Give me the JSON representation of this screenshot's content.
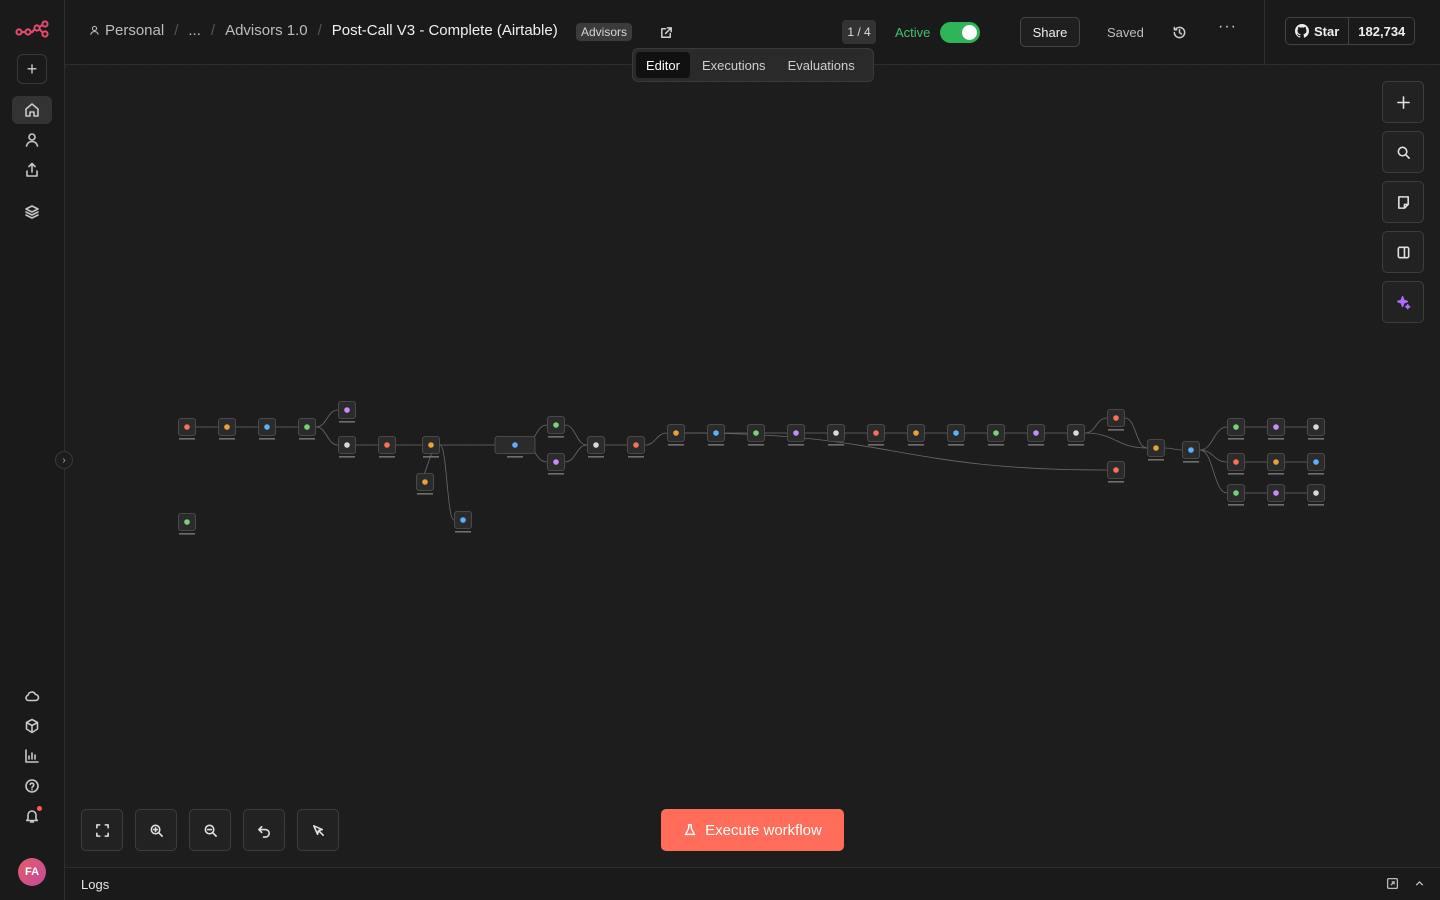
{
  "header": {
    "breadcrumbs": [
      "Personal",
      "...",
      "Advisors 1.0"
    ],
    "workflow_title": "Post-Call V3 - Complete (Airtable)",
    "tag": "Advisors",
    "pager": "1 / 4",
    "active_label": "Active",
    "active": true,
    "share_label": "Share",
    "saved_label": "Saved",
    "github": {
      "star_label": "Star",
      "star_count": "182,734"
    }
  },
  "tabs": [
    {
      "label": "Editor",
      "selected": true
    },
    {
      "label": "Executions",
      "selected": false
    },
    {
      "label": "Evaluations",
      "selected": false
    }
  ],
  "sidebar": {
    "avatar_initials": "FA",
    "top_icons": [
      "home-icon",
      "user-icon",
      "share-icon",
      "layers-icon"
    ],
    "bottom_icons": [
      "cloud-icon",
      "templates-icon",
      "insights-icon",
      "help-icon",
      "bell-icon"
    ]
  },
  "canvas": {
    "execute_label": "Execute workflow",
    "right_tools": [
      "plus-icon",
      "search-icon",
      "sticky-note-icon",
      "panel-icon",
      "ai-sparkle-icon"
    ],
    "bottom_tools": [
      "fit-view-icon",
      "zoom-in-icon",
      "zoom-out-icon",
      "undo-icon",
      "tidy-up-icon"
    ]
  },
  "logs": {
    "label": "Logs"
  },
  "colors": {
    "accent": "#ff6d5a",
    "active_green": "#2fb459",
    "canvas_bg": "#1d1d1d"
  }
}
